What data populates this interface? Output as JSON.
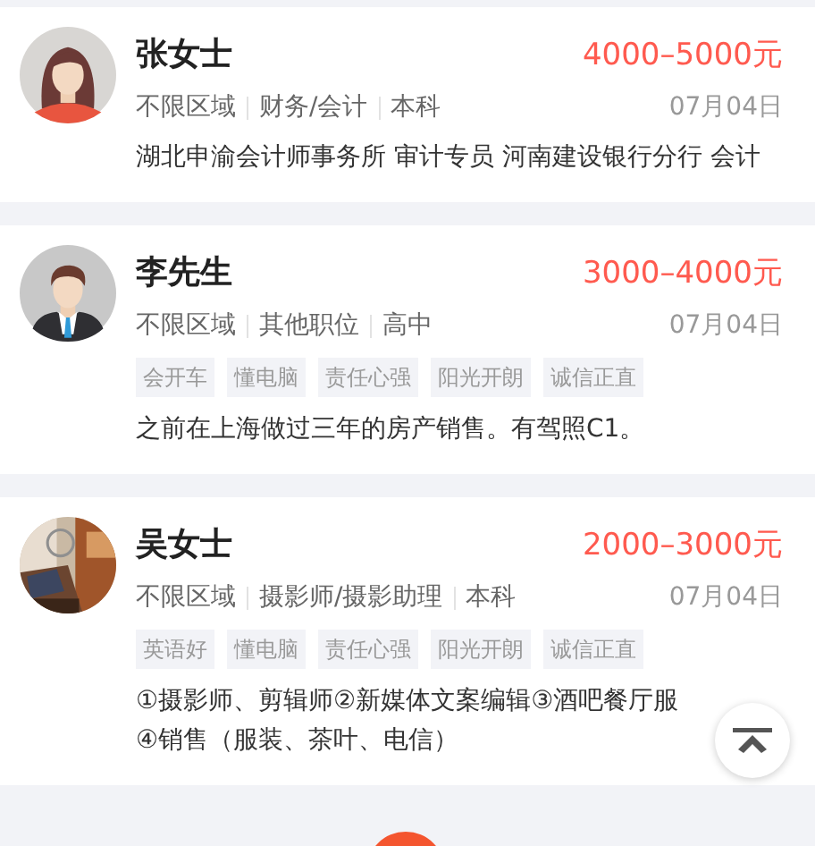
{
  "candidates": [
    {
      "name": "张女士",
      "avatar": {
        "kind": "female"
      },
      "salary": "4000–5000元",
      "meta": [
        "不限区域",
        "财务/会计",
        "本科"
      ],
      "date": "07月04日",
      "description": [
        "湖北申渝会计师事务所 审计专员 河南建设银行分行 会计"
      ]
    },
    {
      "name": "李先生",
      "avatar": {
        "kind": "male"
      },
      "salary": "3000–4000元",
      "meta": [
        "不限区域",
        "其他职位",
        "高中"
      ],
      "date": "07月04日",
      "tags": [
        "会开车",
        "懂电脑",
        "责任心强",
        "阳光开朗",
        "诚信正直"
      ],
      "description": [
        "之前在上海做过三年的房产销售。有驾照C1。"
      ]
    },
    {
      "name": "吴女士",
      "avatar": {
        "kind": "picture"
      },
      "salary": "2000–3000元",
      "meta": [
        "不限区域",
        "摄影师/摄影助理",
        "本科"
      ],
      "date": "07月04日",
      "tags": [
        "英语好",
        "懂电脑",
        "责任心强",
        "阳光开朗",
        "诚信正直"
      ],
      "description": [
        "①摄影师、剪辑师②新媒体文案编辑③酒吧餐厅服",
        "④销售（服装、茶叶、电信）"
      ]
    }
  ]
}
